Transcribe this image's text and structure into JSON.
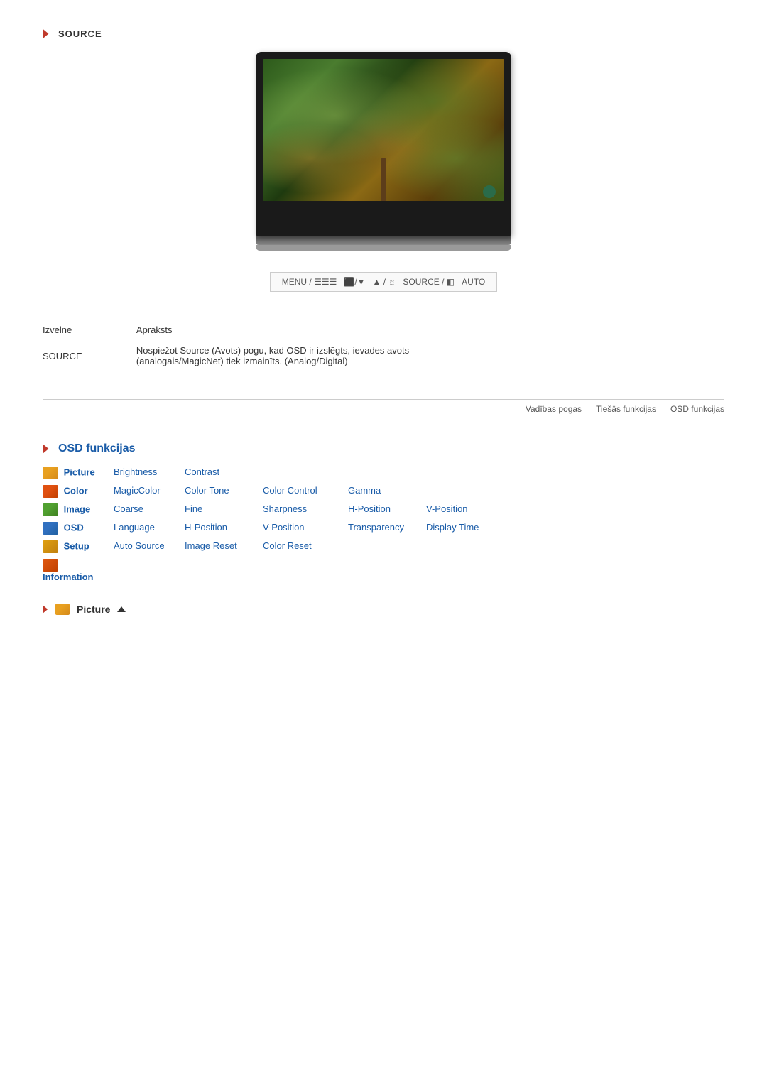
{
  "source_section": {
    "label": "SOURCE",
    "button_bar": {
      "items": [
        "MENU / ☰☰☰",
        "⬛/▼",
        "▲ / ☼",
        "SOURCE / ◧",
        "AUTO"
      ]
    }
  },
  "description": {
    "col1_header": "Izvēlne",
    "col2_header": "Apraksts",
    "rows": [
      {
        "menu": "SOURCE",
        "desc": "Nospiežot Source (Avots) pogu, kad OSD ir izslēgts, ievades avots\n(analogais/MagicNet) tiek izmainīts. (Analog/Digital)"
      }
    ]
  },
  "nav_links": {
    "vadibas": "Vadības pogas",
    "tieshas": "Tiešās funkcijas",
    "osd": "OSD funkcijas"
  },
  "osd_section": {
    "title": "OSD funkcijas",
    "rows": [
      {
        "icon": "picture",
        "menu": "Picture",
        "col2": "Brightness",
        "col3": "Contrast",
        "col4": "",
        "col5": "",
        "col6": ""
      },
      {
        "icon": "color",
        "menu": "Color",
        "col2": "MagicColor",
        "col3": "Color Tone",
        "col4": "Color Control",
        "col5": "Gamma",
        "col6": ""
      },
      {
        "icon": "image",
        "menu": "Image",
        "col2": "Coarse",
        "col3": "Fine",
        "col4": "Sharpness",
        "col5": "H-Position",
        "col6": "V-Position"
      },
      {
        "icon": "osd",
        "menu": "OSD",
        "col2": "Language",
        "col3": "H-Position",
        "col4": "V-Position",
        "col5": "Transparency",
        "col6": "Display Time"
      },
      {
        "icon": "setup",
        "menu": "Setup",
        "col2": "Auto Source",
        "col3": "Image Reset",
        "col4": "Color Reset",
        "col5": "",
        "col6": ""
      },
      {
        "icon": "info",
        "menu": "Information",
        "col2": "",
        "col3": "",
        "col4": "",
        "col5": "",
        "col6": ""
      }
    ]
  },
  "picture_footer": {
    "label": "Picture"
  }
}
